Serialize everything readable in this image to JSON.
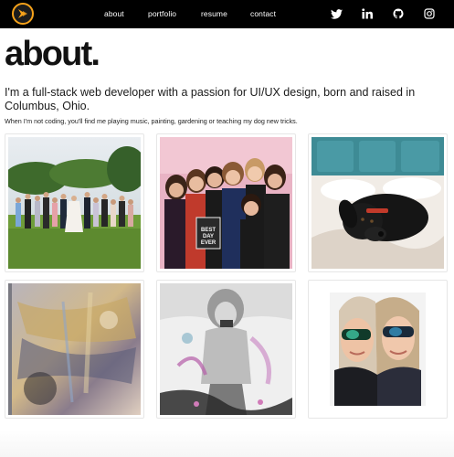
{
  "nav": {
    "links": [
      {
        "label": "about"
      },
      {
        "label": "portfolio"
      },
      {
        "label": "resume"
      },
      {
        "label": "contact"
      }
    ],
    "social": [
      {
        "icon": "twitter-icon"
      },
      {
        "icon": "linkedin-icon"
      },
      {
        "icon": "github-icon"
      },
      {
        "icon": "instagram-icon"
      }
    ]
  },
  "about": {
    "title": "about.",
    "lead": "I'm a full-stack web developer with a passion for UI/UX design, born and raised in Columbus, Ohio.",
    "subtext": "When I'm not coding, you'll find me playing music, painting, gardening or teaching my dog new tricks."
  },
  "gallery": {
    "photos": [
      {
        "subject": "wedding-party-photo"
      },
      {
        "subject": "group-of-friends-photo",
        "sign": "BEST DAY EVER"
      },
      {
        "subject": "black-dog-on-bed-photo"
      },
      {
        "subject": "abstract-painting-photo"
      },
      {
        "subject": "painting-of-woman-photo"
      },
      {
        "subject": "selfie-with-sunglasses-photo"
      }
    ]
  },
  "colors": {
    "navbar": "#000000",
    "logo_accent": "#f6a21a",
    "text": "#111111"
  }
}
